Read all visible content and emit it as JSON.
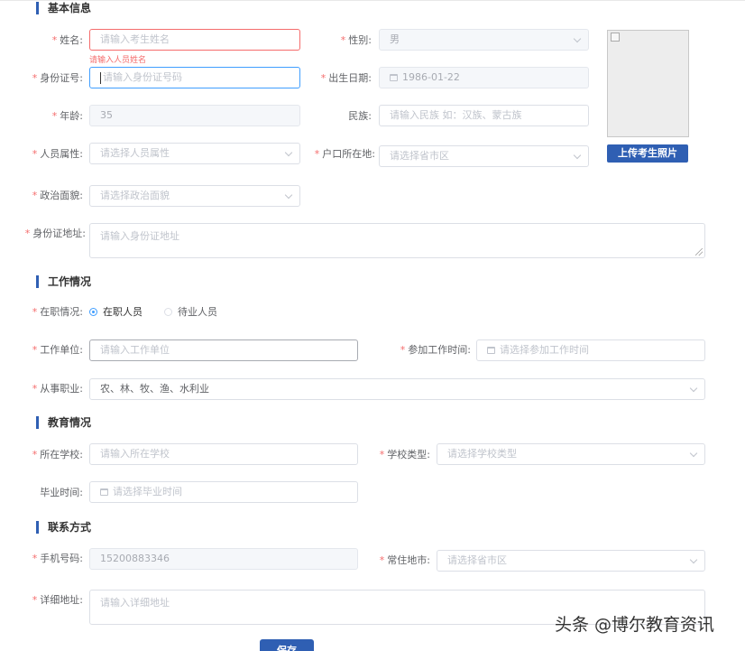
{
  "sections": {
    "basic": "基本信息",
    "work": "工作情况",
    "education": "教育情况",
    "contact": "联系方式"
  },
  "basic": {
    "name": {
      "label": "姓名:",
      "placeholder": "请输入考生姓名",
      "error": "请输入人员姓名"
    },
    "gender": {
      "label": "性别:",
      "value": "男"
    },
    "id_number": {
      "label": "身份证号:",
      "placeholder": "请输入身份证号码"
    },
    "birth_date": {
      "label": "出生日期:",
      "value": "1986-01-22"
    },
    "age": {
      "label": "年龄:",
      "value": "35"
    },
    "ethnicity": {
      "label": "民族:",
      "placeholder": "请输入民族 如：汉族、蒙古族"
    },
    "person_type": {
      "label": "人员属性:",
      "placeholder": "请选择人员属性"
    },
    "hukou": {
      "label": "户口所在地:",
      "placeholder": "请选择省市区"
    },
    "political": {
      "label": "政治面貌:",
      "placeholder": "请选择政治面貌"
    },
    "id_address": {
      "label": "身份证地址:",
      "placeholder": "请输入身份证地址"
    },
    "upload_photo": "上传考生照片"
  },
  "work": {
    "status": {
      "label": "在职情况:",
      "options": [
        "在职人员",
        "待业人员"
      ],
      "selected": "在职人员"
    },
    "employer": {
      "label": "工作单位:",
      "placeholder": "请输入工作单位"
    },
    "start_time": {
      "label": "参加工作时间:",
      "placeholder": "请选择参加工作时间"
    },
    "occupation": {
      "label": "从事职业:",
      "value": "农、林、牧、渔、水利业"
    }
  },
  "education": {
    "school": {
      "label": "所在学校:",
      "placeholder": "请输入所在学校"
    },
    "school_type": {
      "label": "学校类型:",
      "placeholder": "请选择学校类型"
    },
    "graduation": {
      "label": "毕业时间:",
      "placeholder": "请选择毕业时间"
    }
  },
  "contact": {
    "phone": {
      "label": "手机号码:",
      "value": "15200883346"
    },
    "residence": {
      "label": "常住地市:",
      "placeholder": "请选择省市区"
    },
    "address": {
      "label": "详细地址:",
      "placeholder": "请输入详细地址"
    }
  },
  "save_label": "保存",
  "watermark": "头条 @博尔教育资讯",
  "colors": {
    "accent": "#2f5fb3",
    "required": "#f56c6c",
    "focus": "#409eff"
  }
}
